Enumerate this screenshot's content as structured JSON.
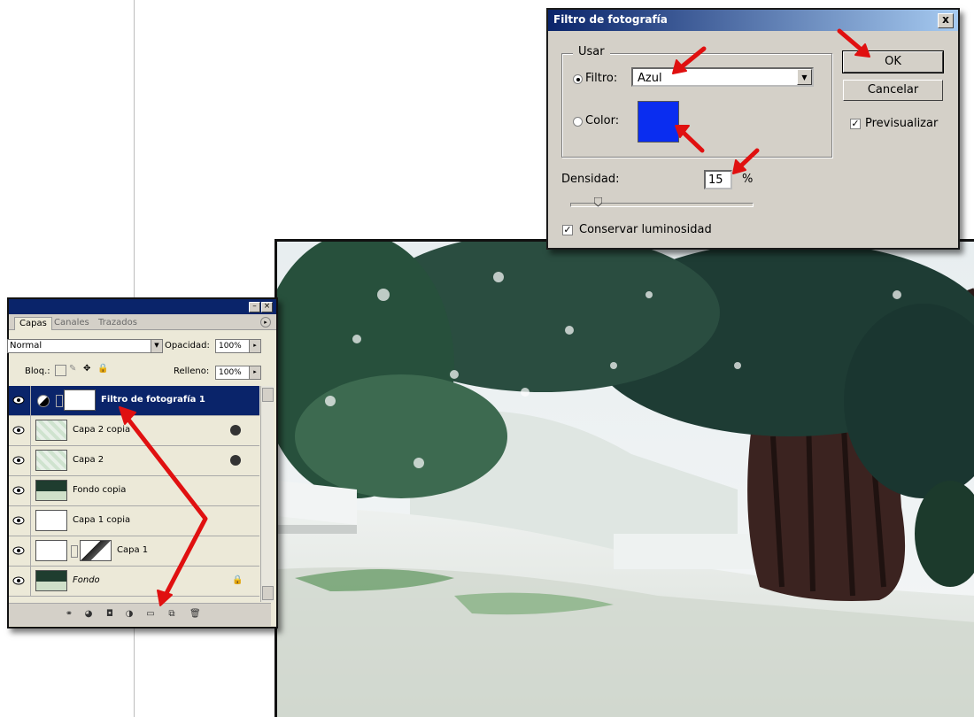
{
  "dialog": {
    "title": "Filtro de fotografía",
    "close_label": "x",
    "usar_label": "Usar",
    "filtro_label": "Filtro:",
    "filtro_value": "Azul",
    "color_label": "Color:",
    "color_swatch": "#0a2df0",
    "densidad_label": "Densidad:",
    "densidad_value": "15",
    "percent_sign": "%",
    "densidad_slider_percent": 15,
    "conservar_label": "Conservar luminosidad",
    "ok_label": "OK",
    "cancel_label": "Cancelar",
    "preview_label": "Previsualizar",
    "preview_checked": true,
    "conservar_checked": true
  },
  "layers_panel": {
    "tabs": [
      "Capas",
      "Canales",
      "Trazados"
    ],
    "blend_mode": "Normal",
    "opacity_label": "Opacidad:",
    "opacity_value": "100%",
    "lock_label": "Bloq.:",
    "fill_label": "Relleno:",
    "fill_value": "100%",
    "layers": [
      {
        "name": "Filtro de fotografía 1",
        "selected": true
      },
      {
        "name": "Capa 2 copia"
      },
      {
        "name": "Capa 2"
      },
      {
        "name": "Fondo copia"
      },
      {
        "name": "Capa 1 copia"
      },
      {
        "name": "Capa 1"
      },
      {
        "name": "Fondo",
        "italic": true
      }
    ]
  },
  "colors": {
    "arrow": "#e01010",
    "titlebar": "#0a246a",
    "dialog_bg": "#d4d0c8"
  }
}
